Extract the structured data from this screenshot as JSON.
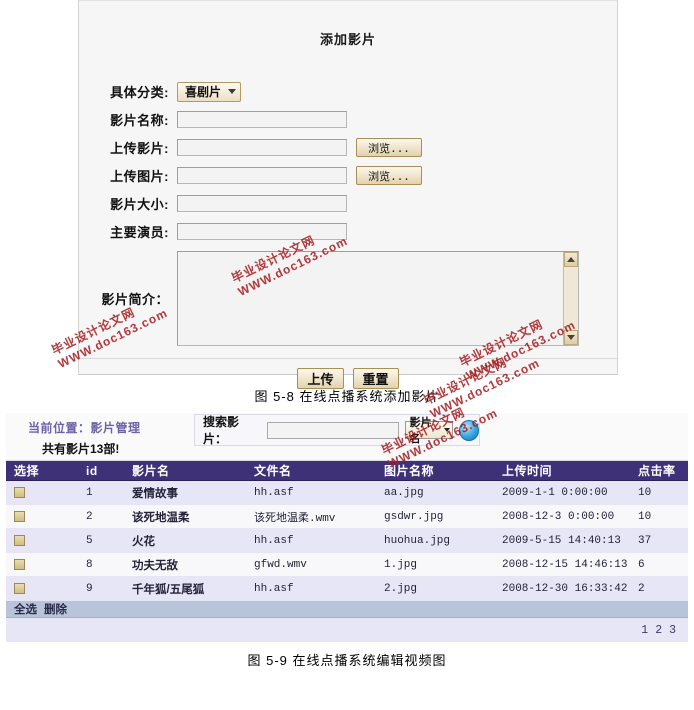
{
  "figure1": {
    "panel_title": "添加影片",
    "caption": "图 5-8  在线点播系统添加影片",
    "fields": {
      "category_label": "具体分类:",
      "category_value": "喜剧片",
      "name_label": "影片名称:",
      "name_value": "",
      "upload_movie_label": "上传影片:",
      "upload_movie_value": "",
      "upload_image_label": "上传图片:",
      "upload_image_value": "",
      "size_label": "影片大小:",
      "size_value": "",
      "actors_label": "主要演员:",
      "actors_value": "",
      "intro_label": "影片简介：",
      "intro_value": "",
      "browse_label": "浏览..."
    },
    "actions": {
      "submit_label": "上传",
      "reset_label": "重置"
    }
  },
  "figure2": {
    "caption": "图 5-9  在线点播系统编辑视频图",
    "breadcrumb": "当前位置：影片管理",
    "count_text": "共有影片13部!",
    "search": {
      "label": "搜索影片：",
      "input_value": "",
      "input_placeholder": "",
      "field_select_value": "影片名",
      "search_icon": "search-icon"
    },
    "table": {
      "columns": [
        "选择",
        "id",
        "影片名",
        "文件名",
        "图片名称",
        "上传时间",
        "点击率"
      ],
      "rows": [
        {
          "id": "1",
          "movie": "爱情故事",
          "file": "hh.asf",
          "image": "aa.jpg",
          "time": "2009-1-1 0:00:00",
          "hits": "10"
        },
        {
          "id": "2",
          "movie": "该死地温柔",
          "file": "该死地温柔.wmv",
          "image": "gsdwr.jpg",
          "time": "2008-12-3 0:00:00",
          "hits": "10"
        },
        {
          "id": "5",
          "movie": "火花",
          "file": "hh.asf",
          "image": "huohua.jpg",
          "time": "2009-5-15 14:40:13",
          "hits": "37"
        },
        {
          "id": "8",
          "movie": "功夫无敌",
          "file": "gfwd.wmv",
          "image": "1.jpg",
          "time": "2008-12-15 14:46:13",
          "hits": "6"
        },
        {
          "id": "9",
          "movie": "千年狐/五尾狐",
          "file": "hh.asf",
          "image": "2.jpg",
          "time": "2008-12-30 16:33:42",
          "hits": "2"
        }
      ]
    },
    "footer": {
      "select_all_label": "全选",
      "delete_label": "删除"
    },
    "pagination": [
      "1",
      "2",
      "3"
    ]
  },
  "watermark": {
    "line1": "毕业设计论文网",
    "line2": "WWW.doc163.com",
    "color": "#a81f22"
  }
}
